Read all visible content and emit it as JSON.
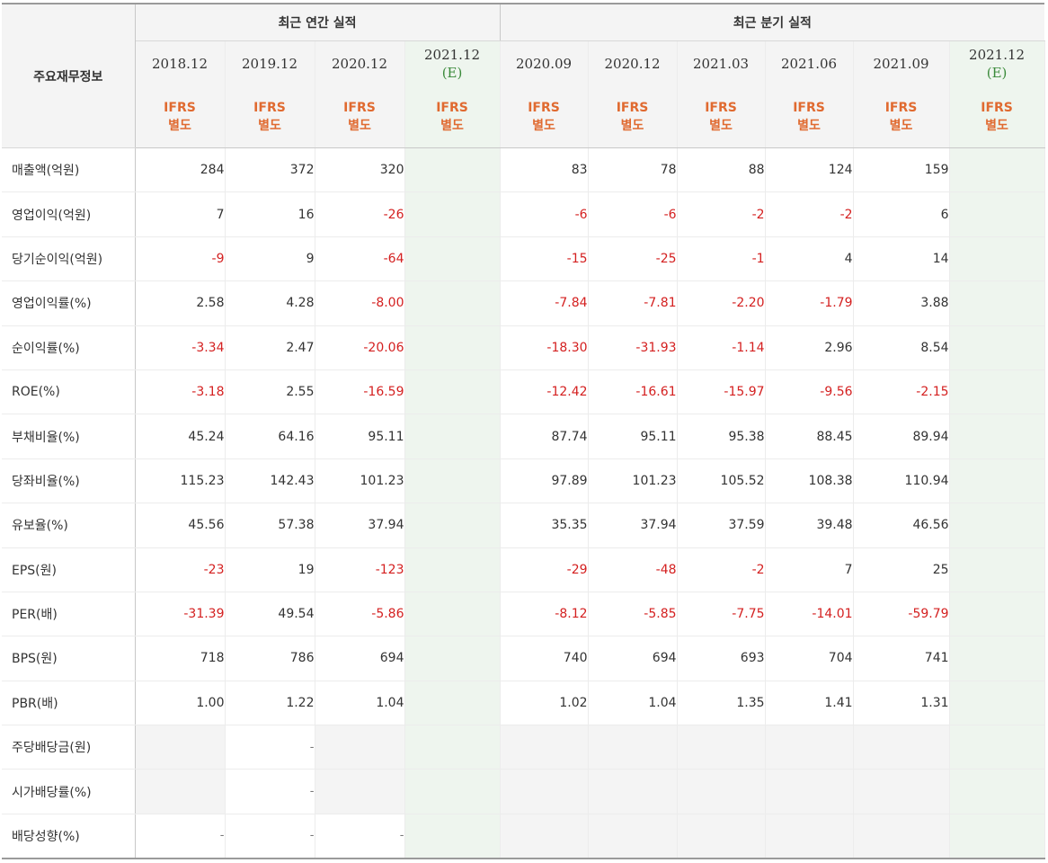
{
  "header": {
    "corner_label": "주요재무정보",
    "annual_group": "최근 연간 실적",
    "quarter_group": "최근 분기 실적",
    "periods": [
      "2018.12",
      "2019.12",
      "2020.12",
      "2021.12",
      "2020.09",
      "2020.12",
      "2021.03",
      "2021.06",
      "2021.09",
      "2021.12"
    ],
    "estimate_mark": "(E)",
    "accounting_line1": "IFRS",
    "accounting_line2": "별도"
  },
  "rows": [
    {
      "label": "매출액(억원)",
      "values": [
        "284",
        "372",
        "320",
        "",
        "83",
        "78",
        "88",
        "124",
        "159",
        ""
      ]
    },
    {
      "label": "영업이익(억원)",
      "values": [
        "7",
        "16",
        "-26",
        "",
        "-6",
        "-6",
        "-2",
        "-2",
        "6",
        ""
      ]
    },
    {
      "label": "당기순이익(억원)",
      "values": [
        "-9",
        "9",
        "-64",
        "",
        "-15",
        "-25",
        "-1",
        "4",
        "14",
        ""
      ]
    },
    {
      "label": "영업이익률(%)",
      "values": [
        "2.58",
        "4.28",
        "-8.00",
        "",
        "-7.84",
        "-7.81",
        "-2.20",
        "-1.79",
        "3.88",
        ""
      ]
    },
    {
      "label": "순이익률(%)",
      "values": [
        "-3.34",
        "2.47",
        "-20.06",
        "",
        "-18.30",
        "-31.93",
        "-1.14",
        "2.96",
        "8.54",
        ""
      ]
    },
    {
      "label": "ROE(%)",
      "values": [
        "-3.18",
        "2.55",
        "-16.59",
        "",
        "-12.42",
        "-16.61",
        "-15.97",
        "-9.56",
        "-2.15",
        ""
      ]
    },
    {
      "label": "부채비율(%)",
      "values": [
        "45.24",
        "64.16",
        "95.11",
        "",
        "87.74",
        "95.11",
        "95.38",
        "88.45",
        "89.94",
        ""
      ]
    },
    {
      "label": "당좌비율(%)",
      "values": [
        "115.23",
        "142.43",
        "101.23",
        "",
        "97.89",
        "101.23",
        "105.52",
        "108.38",
        "110.94",
        ""
      ]
    },
    {
      "label": "유보율(%)",
      "values": [
        "45.56",
        "57.38",
        "37.94",
        "",
        "35.35",
        "37.94",
        "37.59",
        "39.48",
        "46.56",
        ""
      ]
    },
    {
      "label": "EPS(원)",
      "values": [
        "-23",
        "19",
        "-123",
        "",
        "-29",
        "-48",
        "-2",
        "7",
        "25",
        ""
      ]
    },
    {
      "label": "PER(배)",
      "values": [
        "-31.39",
        "49.54",
        "-5.86",
        "",
        "-8.12",
        "-5.85",
        "-7.75",
        "-14.01",
        "-59.79",
        ""
      ]
    },
    {
      "label": "BPS(원)",
      "values": [
        "718",
        "786",
        "694",
        "",
        "740",
        "694",
        "693",
        "704",
        "741",
        ""
      ]
    },
    {
      "label": "PBR(배)",
      "values": [
        "1.00",
        "1.22",
        "1.04",
        "",
        "1.02",
        "1.04",
        "1.35",
        "1.41",
        "1.31",
        ""
      ]
    },
    {
      "label": "주당배당금(원)",
      "values": [
        "",
        "-",
        "",
        "",
        "",
        "",
        "",
        "",
        "",
        ""
      ]
    },
    {
      "label": "시가배당률(%)",
      "values": [
        "",
        "-",
        "",
        "",
        "",
        "",
        "",
        "",
        "",
        ""
      ]
    },
    {
      "label": "배당성향(%)",
      "values": [
        "-",
        "-",
        "-",
        "",
        "",
        "",
        "",
        "",
        "",
        ""
      ]
    }
  ],
  "colors": {
    "negative": "#d42020",
    "accounting": "#e06a30",
    "estimate_mark": "#3a8a3a",
    "estimate_bg": "#eef5ee",
    "empty_bg": "#f4f4f4"
  }
}
